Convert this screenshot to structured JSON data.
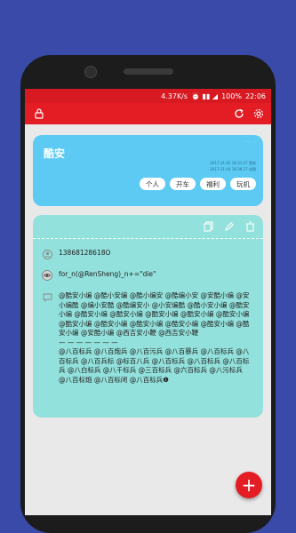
{
  "statusbar": {
    "speed": "4.37K/s",
    "battery": "100%",
    "time": "22:06"
  },
  "appbar": {
    "lock_icon": "lock-icon",
    "refresh_icon": "refresh-icon",
    "settings_icon": "gear-icon"
  },
  "card1": {
    "title": "酷安",
    "dots": "·· ·",
    "date1": "2017-11-02 18:31:27 更新",
    "date2": "2017-11-04 18:36:17 创建",
    "tags": [
      "个人",
      "开车",
      "福利",
      "玩机"
    ]
  },
  "card2": {
    "phone": "13868128618O",
    "formula": "for_n(@RenSheng)_n+=\"die\"",
    "note": "@酷安小编 @酷小安编 @酷小编安 @酷编小安 @安酷小编 @安小编酷 @编小安酷 @酷编安小 @小安编酷 @酷小安小编 @酷安小编 @酷安小编 @酷安小编 @酷安小编 @酷安小编 @酷安小编 @酷安小编 @酷安小编 @酷安小编 @酷安小编 @酷安小编 @酷安小编 @安酷小编 @西吉安小鞭 @西吉安小鞭\n— — — — — — —\n@八百标兵 @八百炮兵 @八百污兵 @八百暴兵 @八百标兵 @八百标兵 @八百兵标 @标百八兵 @八百标兵 @八百标兵 @八百标兵 @八白标兵 @八千标兵 @三百标兵 @六百标兵 @八污标兵 @八百标炮 @八百标闭 @八百标兵❶"
  },
  "fab": {
    "label": "+"
  }
}
